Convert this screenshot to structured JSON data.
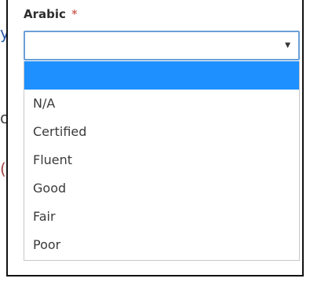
{
  "field": {
    "label": "Arabic",
    "required_marker": "*",
    "selected_value": "",
    "arrow_glyph": "▼"
  },
  "dropdown": {
    "options": [
      "",
      "N/A",
      "Certified",
      "Fluent",
      "Good",
      "Fair",
      "Poor"
    ],
    "highlighted_index": 0
  },
  "background": {
    "fragments": [
      "y",
      "o",
      "("
    ],
    "arrow_glyph": "▼"
  },
  "colors": {
    "highlight": "#1e90ff",
    "focus_border": "#6a9fd6",
    "required": "#c0392b"
  }
}
